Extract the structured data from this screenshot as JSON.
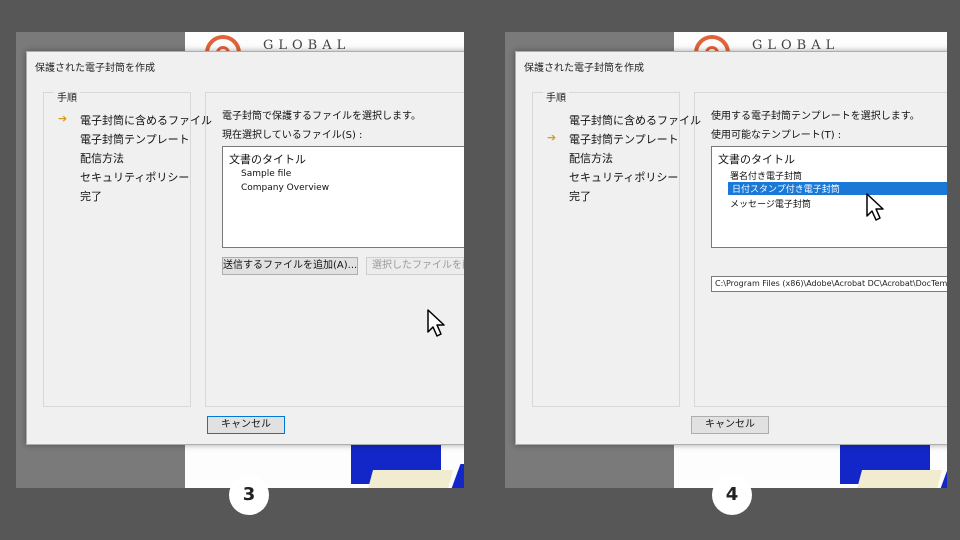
{
  "panels": [
    {
      "logo_text": "GLOBAL",
      "dialog_title": "保護された電子封筒を作成",
      "steps_heading": "手順",
      "steps": [
        "電子封筒に含めるファイル",
        "電子封筒テンプレート",
        "配信方法",
        "セキュリティポリシー",
        "完了"
      ],
      "current_step_icon": "arrow-right-icon",
      "instruction": "電子封筒で保護するファイルを選択します。",
      "list_label": "現在選択しているファイル(S) :",
      "list_heading": "文書のタイトル",
      "list_items": [
        "Sample file",
        "Company Overview"
      ],
      "add_button": "送信するファイルを追加(A)...",
      "remove_button": "選択したファイルを削除",
      "cancel_button": "キャンセル",
      "badge": "3"
    },
    {
      "logo_text": "GLOBAL",
      "dialog_title": "保護された電子封筒を作成",
      "steps_heading": "手順",
      "steps": [
        "電子封筒に含めるファイル",
        "電子封筒テンプレート",
        "配信方法",
        "セキュリティポリシー",
        "完了"
      ],
      "current_step_icon": "arrow-right-icon",
      "instruction": "使用する電子封筒テンプレートを選択します。",
      "list_label": "使用可能なテンプレート(T) :",
      "list_heading": "文書のタイトル",
      "list_items": [
        "署名付き電子封筒",
        "日付スタンプ付き電子封筒",
        "メッセージ電子封筒"
      ],
      "selected_item": "日付スタンプ付き電子封筒",
      "path_value": "C:\\Program Files (x86)\\Adobe\\Acrobat DC\\Acrobat\\DocTem",
      "cancel_button": "キャンセル",
      "badge": "4"
    }
  ],
  "colors": {
    "arrow": "#d89a18",
    "selection": "#1a78d7",
    "logo": "#e0633a",
    "shape": "#1326c8"
  }
}
